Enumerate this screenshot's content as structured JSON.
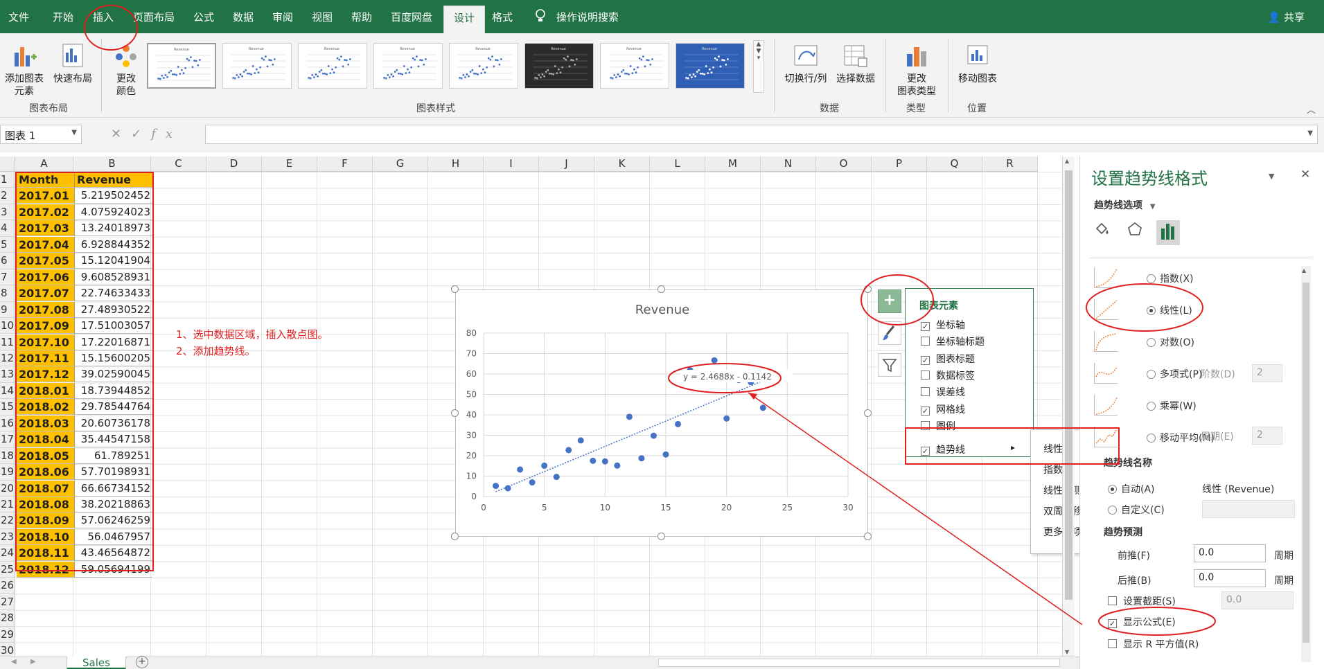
{
  "ribbon": {
    "tabs": [
      "文件",
      "开始",
      "插入",
      "页面布局",
      "公式",
      "数据",
      "审阅",
      "视图",
      "帮助",
      "百度网盘",
      "设计",
      "格式"
    ],
    "active_tab": "设计",
    "tell_me": "操作说明搜索",
    "share": "共享",
    "add_element": "添加图表\n元素",
    "quick_layout": "快速布局",
    "change_colors": "更改\n颜色",
    "group_layout": "图表布局",
    "group_styles": "图表样式",
    "style_thumb_title": "Revenue",
    "switch_row_col": "切换行/列",
    "select_data": "选择数据",
    "group_data": "数据",
    "change_type": "更改\n图表类型",
    "group_type": "类型",
    "move_chart": "移动图表",
    "group_location": "位置"
  },
  "formula_bar": {
    "name_box": "图表 1",
    "cancel_icon": "✕",
    "enter_icon": "✓",
    "fx_label": "fx",
    "value": ""
  },
  "columns": [
    "A",
    "B",
    "C",
    "D",
    "E",
    "F",
    "G",
    "H",
    "I",
    "J",
    "K",
    "L",
    "M",
    "N",
    "O",
    "P",
    "Q",
    "R"
  ],
  "rows": [
    "1",
    "2",
    "3",
    "4",
    "5",
    "6",
    "7",
    "8",
    "9",
    "10",
    "11",
    "12",
    "13",
    "14",
    "15",
    "16",
    "17",
    "18",
    "19",
    "20",
    "21",
    "22",
    "23",
    "24",
    "25",
    "26",
    "27",
    "28",
    "29",
    "30"
  ],
  "table": {
    "header": [
      "Month",
      "Revenue"
    ],
    "months": [
      "2017.01",
      "2017.02",
      "2017.03",
      "2017.04",
      "2017.05",
      "2017.06",
      "2017.07",
      "2017.08",
      "2017.09",
      "2017.10",
      "2017.11",
      "2017.12",
      "2018.01",
      "2018.02",
      "2018.03",
      "2018.04",
      "2018.05",
      "2018.06",
      "2018.07",
      "2018.08",
      "2018.09",
      "2018.10",
      "2018.11",
      "2018.12"
    ],
    "revenue": [
      "5.219502452",
      "4.075924023",
      "13.24018973",
      "6.928844352",
      "15.12041904",
      "9.608528931",
      "22.74633433",
      "27.48930522",
      "17.51003057",
      "17.22016871",
      "15.15600205",
      "39.02590045",
      "18.73944852",
      "29.78544764",
      "20.60736178",
      "35.44547158",
      "61.789251",
      "57.70198931",
      "66.66734152",
      "38.20218863",
      "57.06246259",
      "56.0467957",
      "43.46564872",
      "59.05694199"
    ]
  },
  "notes": [
    "1、选中数据区域，插入散点图。",
    "2、添加趋势线。"
  ],
  "chart_data": {
    "type": "scatter",
    "title": "Revenue",
    "x": [
      1,
      2,
      3,
      4,
      5,
      6,
      7,
      8,
      9,
      10,
      11,
      12,
      13,
      14,
      15,
      16,
      17,
      18,
      19,
      20,
      21,
      22,
      23,
      24
    ],
    "y": [
      5.22,
      4.08,
      13.24,
      6.93,
      15.12,
      9.61,
      22.75,
      27.49,
      17.51,
      17.22,
      15.16,
      39.03,
      18.74,
      29.79,
      20.61,
      35.45,
      61.79,
      57.7,
      66.67,
      38.2,
      57.06,
      56.05,
      43.47,
      59.06
    ],
    "xlim": [
      0,
      30
    ],
    "ylim": [
      0,
      80
    ],
    "xticks": [
      0,
      5,
      10,
      15,
      20,
      25,
      30
    ],
    "yticks": [
      0,
      10,
      20,
      30,
      40,
      50,
      60,
      70,
      80
    ],
    "trendline": {
      "type": "linear",
      "slope": 2.4688,
      "intercept": -0.1142,
      "label": "y = 2.4688x - 0.1142"
    },
    "grid": true,
    "marker_color": "#4472c4"
  },
  "chart_elements": {
    "title": "图表元素",
    "items": [
      {
        "label": "坐标轴",
        "checked": true
      },
      {
        "label": "坐标轴标题",
        "checked": false
      },
      {
        "label": "图表标题",
        "checked": true
      },
      {
        "label": "数据标签",
        "checked": false
      },
      {
        "label": "误差线",
        "checked": false
      },
      {
        "label": "网格线",
        "checked": true
      },
      {
        "label": "图例",
        "checked": false
      },
      {
        "label": "趋势线",
        "checked": true
      }
    ],
    "check_mark": "✓",
    "submenu_arrow": "▸",
    "submenu": [
      "线性",
      "指数",
      "线性预测",
      "双周期移动平均",
      "更多选项..."
    ]
  },
  "pane": {
    "title": "设置趋势线格式",
    "subtitle": "趋势线选项",
    "dropdown_arrow": "▼",
    "close": "✕",
    "options": [
      {
        "label": "指数(X)",
        "selected": false
      },
      {
        "label": "线性(L)",
        "selected": true
      },
      {
        "label": "对数(O)",
        "selected": false
      },
      {
        "label": "多项式(P)",
        "selected": false
      },
      {
        "label": "乘幂(W)",
        "selected": false
      },
      {
        "label": "移动平均(M)",
        "selected": false
      }
    ],
    "order_label": "阶数(D)",
    "order_value": "2",
    "period_label": "周期(E)",
    "period_value": "2",
    "trend_name_label": "趋势线名称",
    "auto_label": "自动(A)",
    "auto_value": "线性 (Revenue)",
    "custom_label": "自定义(C)",
    "forecast_label": "趋势预测",
    "forward_label": "前推(F)",
    "forward_value": "0.0",
    "backward_label": "后推(B)",
    "backward_value": "0.0",
    "unit_period": "周期",
    "intercept_label": "设置截距(S)",
    "intercept_value": "0.0",
    "show_equation_label": "显示公式(E)",
    "show_equation": true,
    "show_r2_label": "显示 R 平方值(R)",
    "show_r2": false
  },
  "sheet": {
    "tab": "Sales",
    "add_icon": "+"
  },
  "colors": {
    "excel_green": "#217346",
    "highlight": "#ffc000",
    "annotation_red": "#e02020"
  }
}
